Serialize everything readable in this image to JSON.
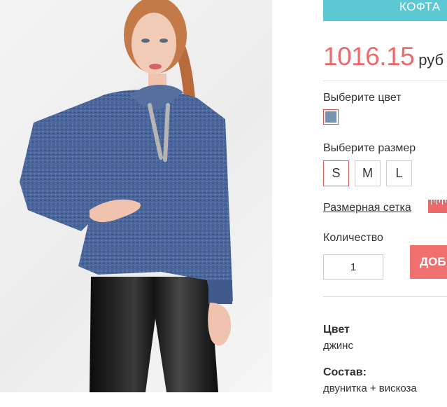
{
  "category_banner": {
    "label": "КОФТА"
  },
  "price": {
    "value": "1016.15",
    "currency": "руб"
  },
  "color_selector": {
    "label": "Выберите цвет",
    "swatch_color": "#7892b1"
  },
  "size_selector": {
    "label": "Выберите размер",
    "options": [
      {
        "label": "S",
        "selected": true
      },
      {
        "label": "M",
        "selected": false
      },
      {
        "label": "L",
        "selected": false
      }
    ]
  },
  "size_chart": {
    "label": "Размерная сетка",
    "icon": "ruler-icon"
  },
  "quantity": {
    "label": "Количество",
    "value": "1"
  },
  "add_to_cart": {
    "label": "ДОБ"
  },
  "specs": [
    {
      "title": "Цвет",
      "value": "джинс"
    },
    {
      "title": "Состав:",
      "value": "двунитка + вискоза"
    }
  ],
  "colors": {
    "accent": "#ec6a6a",
    "banner": "#5bc8d4",
    "add_button": "#f07070",
    "border": "#cccccc"
  }
}
